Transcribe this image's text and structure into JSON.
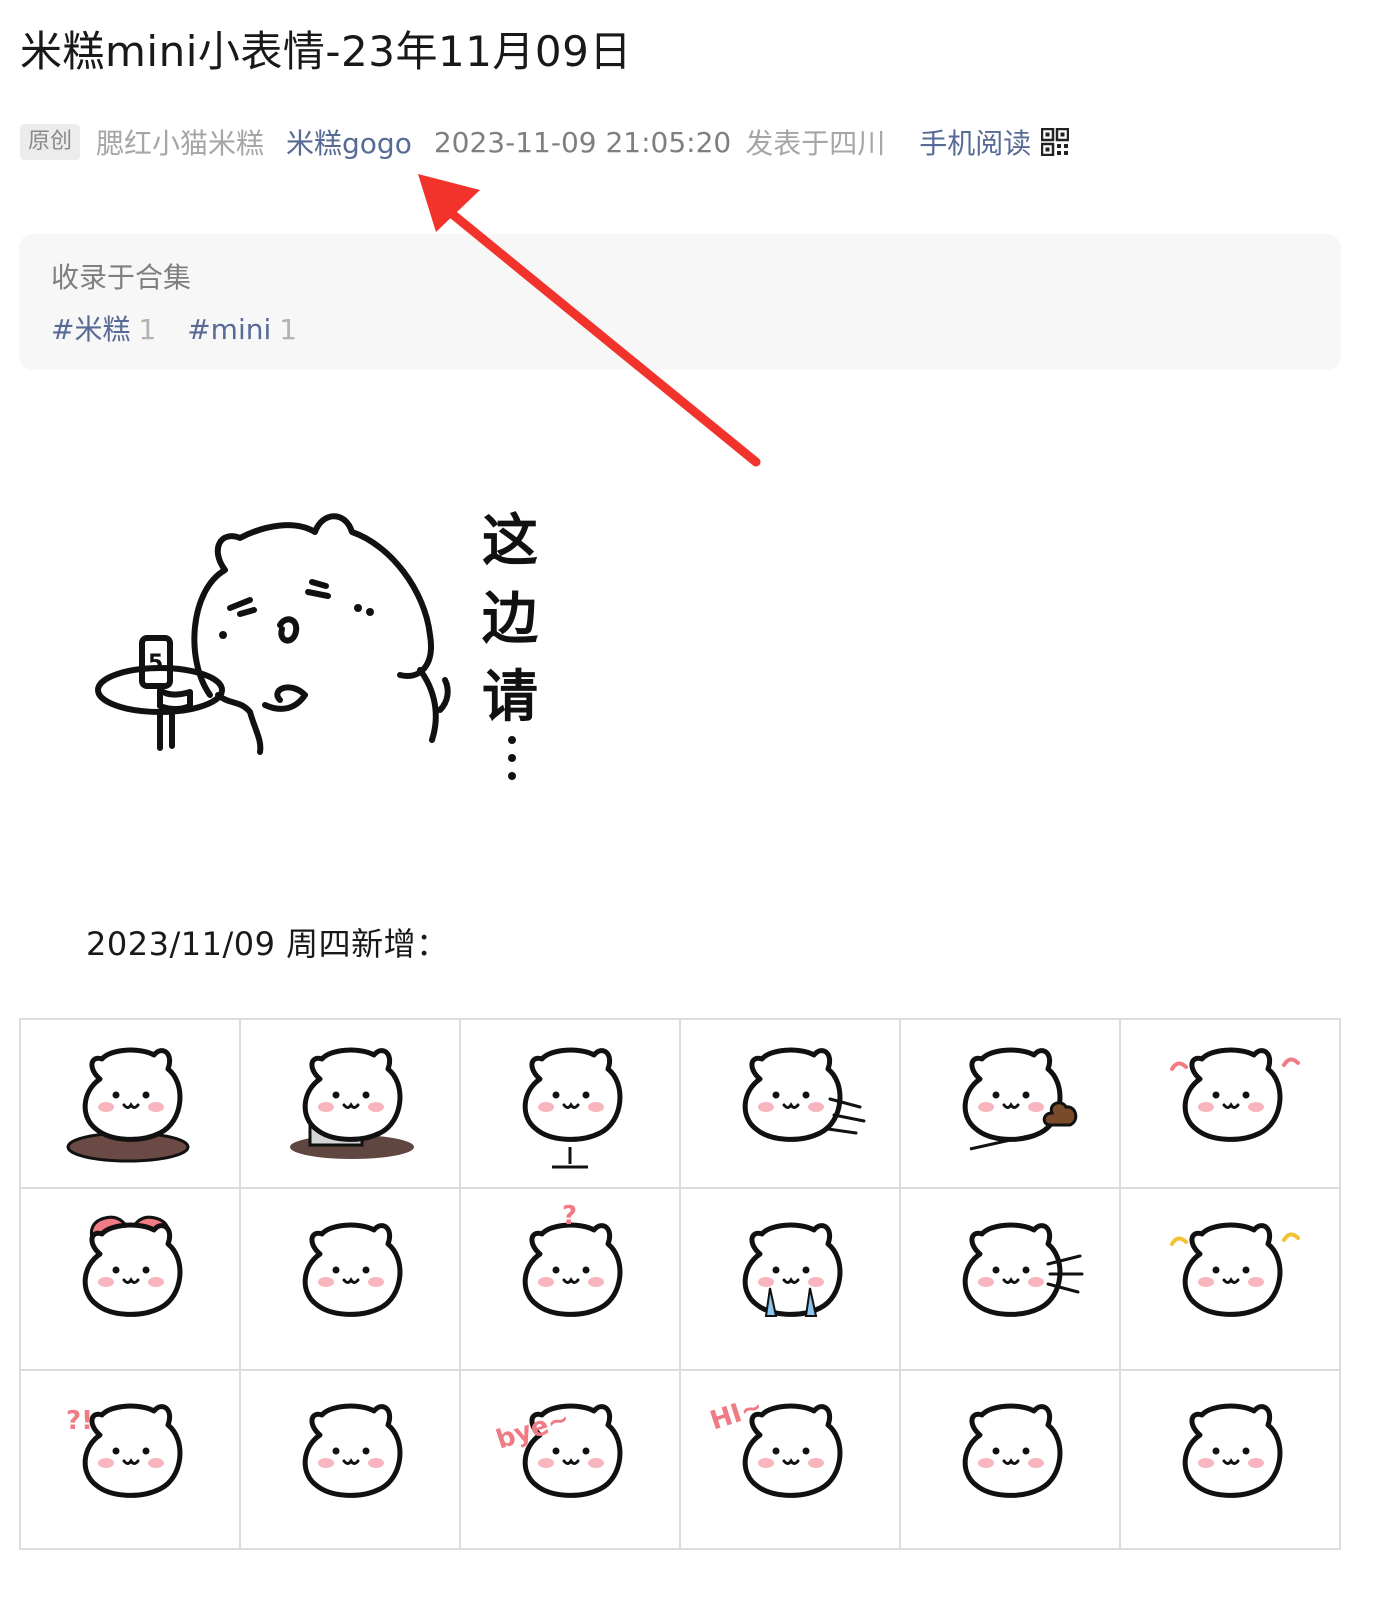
{
  "article": {
    "title": "米糕mini小表情-23年11月09日",
    "meta": {
      "badge": "原创",
      "author": "腮红小猫米糕",
      "account": "米糕gogo",
      "datetime": "2023-11-09 21:05:20",
      "location": "发表于四川",
      "mobile_read": "手机阅读"
    },
    "collection": {
      "label": "收录于合集",
      "tags": [
        {
          "name": "#米糕",
          "count": "1"
        },
        {
          "name": "#mini",
          "count": "1"
        }
      ]
    },
    "banner": {
      "text_chars": [
        "这",
        "边",
        "请",
        "…"
      ],
      "phone_digit": "5"
    },
    "date_line": "2023/11/09 周四新增：",
    "stickers": [
      {
        "name": "sticker-cat-bowing",
        "extra": "mat"
      },
      {
        "name": "sticker-cat-laptop",
        "extra": "laptop"
      },
      {
        "name": "sticker-cat-chair-phone",
        "extra": "chair"
      },
      {
        "name": "sticker-cat-flying",
        "extra": "speed"
      },
      {
        "name": "sticker-cat-poop-shovel",
        "extra": "poop"
      },
      {
        "name": "sticker-cat-happy-clap",
        "extra": "sparkle"
      },
      {
        "name": "sticker-cat-heart",
        "extra": "heart"
      },
      {
        "name": "sticker-cat-small-smile",
        "extra": "none"
      },
      {
        "name": "sticker-cat-question",
        "extra": "question"
      },
      {
        "name": "sticker-cat-crying",
        "extra": "tears"
      },
      {
        "name": "sticker-cat-whiskers",
        "extra": "whiskers"
      },
      {
        "name": "sticker-cat-sparkle",
        "extra": "sparkle2"
      },
      {
        "name": "sticker-cat-kiss-question",
        "extra": "qmark"
      },
      {
        "name": "sticker-cat-sleepy",
        "extra": "none"
      },
      {
        "name": "sticker-cat-bye",
        "extra": "bye"
      },
      {
        "name": "sticker-cat-hi",
        "extra": "hi"
      },
      {
        "name": "sticker-cat-shocked",
        "extra": "none"
      },
      {
        "name": "sticker-cat-walking",
        "extra": "none"
      }
    ],
    "sticker_words": {
      "bye": "bye~",
      "hi": "HI~",
      "question": "?",
      "qmark": "?!"
    },
    "colors": {
      "link": "#576b95",
      "muted": "#a6a6a6",
      "arrow": "#f2332b",
      "blush": "#f7a8b3",
      "heart": "#f07b84",
      "tear": "#8cc6ee"
    },
    "icons": [
      "qr-code-icon",
      "annotation-arrow"
    ]
  }
}
